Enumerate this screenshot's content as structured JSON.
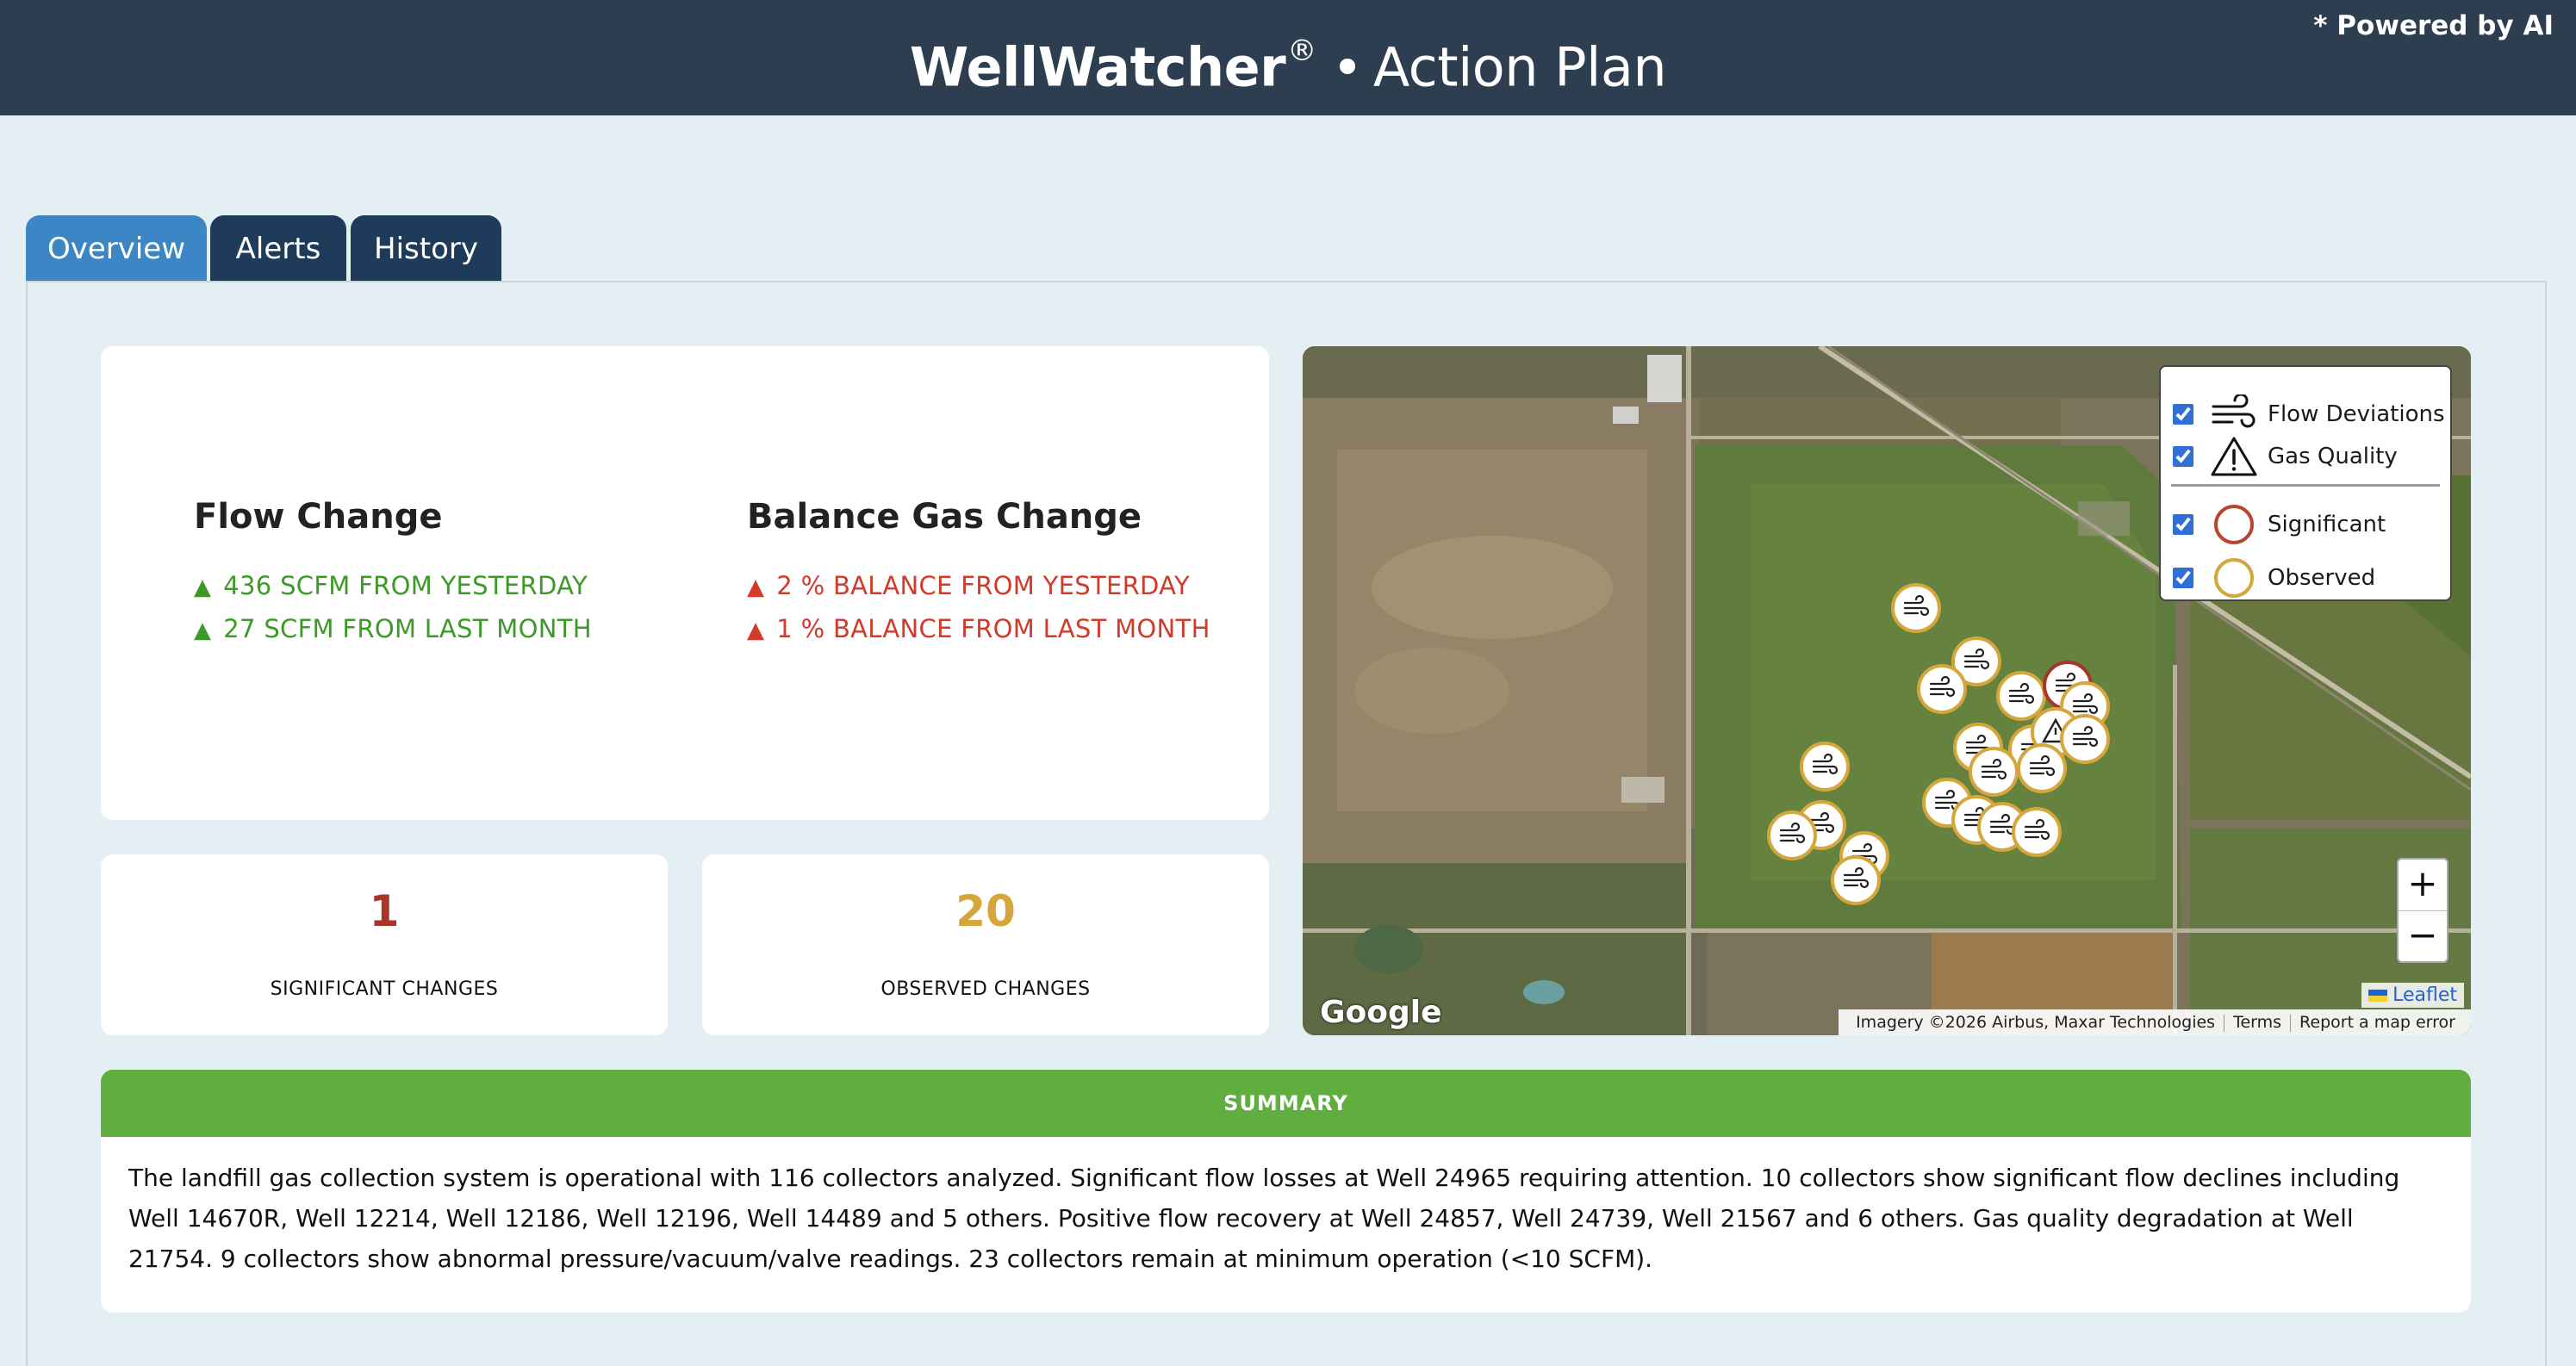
{
  "header": {
    "brand": "WellWatcher",
    "reg": "®",
    "separator": "•",
    "subtitle": "Action Plan",
    "powered": "* Powered by AI"
  },
  "tabs": [
    {
      "label": "Overview",
      "active": true
    },
    {
      "label": "Alerts",
      "active": false
    },
    {
      "label": "History",
      "active": false
    }
  ],
  "flow_change": {
    "title": "Flow Change",
    "lines": [
      "436 SCFM FROM YESTERDAY",
      "27 SCFM FROM LAST MONTH"
    ]
  },
  "balance_gas_change": {
    "title": "Balance Gas Change",
    "lines": [
      "2 % BALANCE FROM YESTERDAY",
      "1 % BALANCE FROM LAST MONTH"
    ]
  },
  "counts": {
    "significant": {
      "value": "1",
      "label": "SIGNIFICANT CHANGES"
    },
    "observed": {
      "value": "20",
      "label": "OBSERVED CHANGES"
    }
  },
  "map": {
    "legend": {
      "flow_deviations": "Flow Deviations",
      "gas_quality": "Gas Quality",
      "significant": "Significant",
      "observed": "Observed"
    },
    "zoom_in": "+",
    "zoom_out": "−",
    "google": "Google",
    "leaflet": "Leaflet",
    "imagery": "Imagery ©2026 Airbus, Maxar Technologies",
    "terms": "Terms",
    "report": "Report a map error"
  },
  "summary": {
    "title": "SUMMARY",
    "text": "The landfill gas collection system is operational with 116 collectors analyzed. Significant flow losses at Well 24965 requiring attention. 10 collectors show significant flow declines including Well 14670R, Well 12214, Well 12186, Well 12196, Well 14489 and 5 others. Positive flow recovery at Well 24857, Well 24739, Well 21567 and 6 others. Gas quality degradation at Well 21754. 9 collectors show abnormal pressure/vacuum/valve readings. 23 collectors remain at minimum operation (<10 SCFM)."
  },
  "colors": {
    "header_bg": "#2c3e50",
    "tab_active": "#3d86c6",
    "tab_inactive": "#1e3c5a",
    "positive": "#3d9a28",
    "negative": "#d23a2a",
    "significant": "#a8352a",
    "observed": "#d4a63c",
    "summary_bar": "#5fae3f"
  }
}
